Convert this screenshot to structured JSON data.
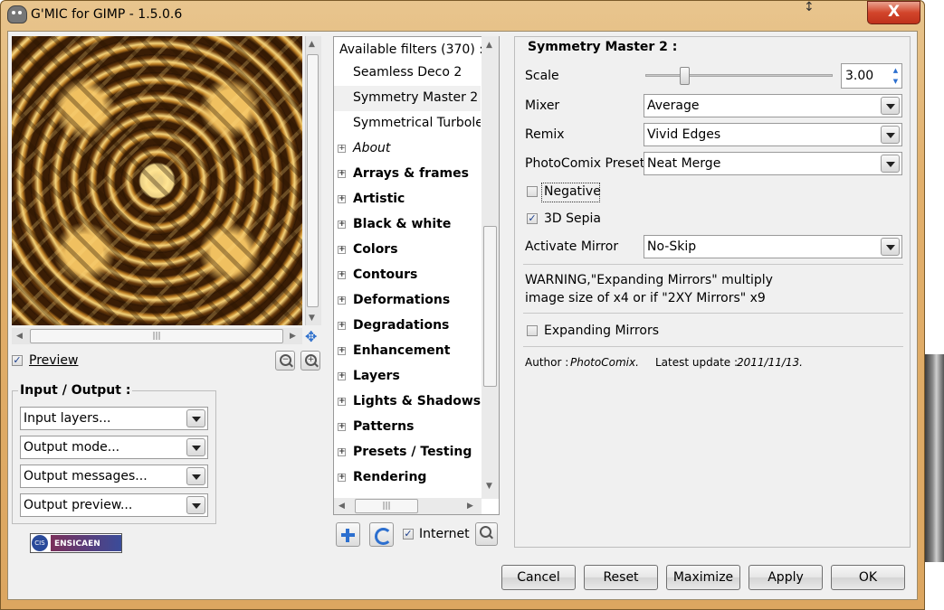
{
  "window": {
    "title": "G'MIC for GIMP - 1.5.0.6",
    "close_label": "X"
  },
  "preview": {
    "checkbox_label": "Preview",
    "checked": true
  },
  "io": {
    "title": "Input / Output :",
    "combos": [
      "Input layers...",
      "Output mode...",
      "Output messages...",
      "Output preview..."
    ]
  },
  "logo": {
    "left_text": "CIS",
    "right_text": "ENSICAEN"
  },
  "filters": {
    "header": "Available filters (370) :",
    "leaves": [
      "Seamless Deco 2",
      "Symmetry Master 2",
      "Symmetrical Turbolen"
    ],
    "categories": [
      "About",
      "Arrays & frames",
      "Artistic",
      "Black & white",
      "Colors",
      "Contours",
      "Deformations",
      "Degradations",
      "Enhancement",
      "Layers",
      "Lights & Shadows",
      "Patterns",
      "Presets / Testing",
      "Rendering"
    ],
    "internet_label": "Internet",
    "internet_checked": true
  },
  "settings": {
    "title": "Symmetry Master 2 :",
    "scale_label": "Scale",
    "scale_value": "3.00",
    "scale_fraction": 0.2,
    "mixer_label": "Mixer",
    "mixer_value": "Average",
    "remix_label": "Remix",
    "remix_value": "Vivid Edges",
    "preset_label": "PhotoComix Preset",
    "preset_value": "Neat Merge",
    "negative_label": "Negative",
    "negative_checked": false,
    "sepia_label": "3D Sepia",
    "sepia_checked": true,
    "mirror_label": "Activate Mirror",
    "mirror_value": "No-Skip",
    "warning_line1": "WARNING,\"Expanding Mirrors\" multiply",
    "warning_line2": "image size of x4 or if \"2XY Mirrors\" x9",
    "expanding_label": "Expanding Mirrors",
    "expanding_checked": false,
    "author_prefix": "Author :",
    "author_name": "PhotoComix.",
    "update_prefix": "Latest update :",
    "update_date": "2011/11/13."
  },
  "buttons": {
    "cancel": "Cancel",
    "reset": "Reset",
    "maximize": "Maximize",
    "apply": "Apply",
    "ok": "OK"
  }
}
